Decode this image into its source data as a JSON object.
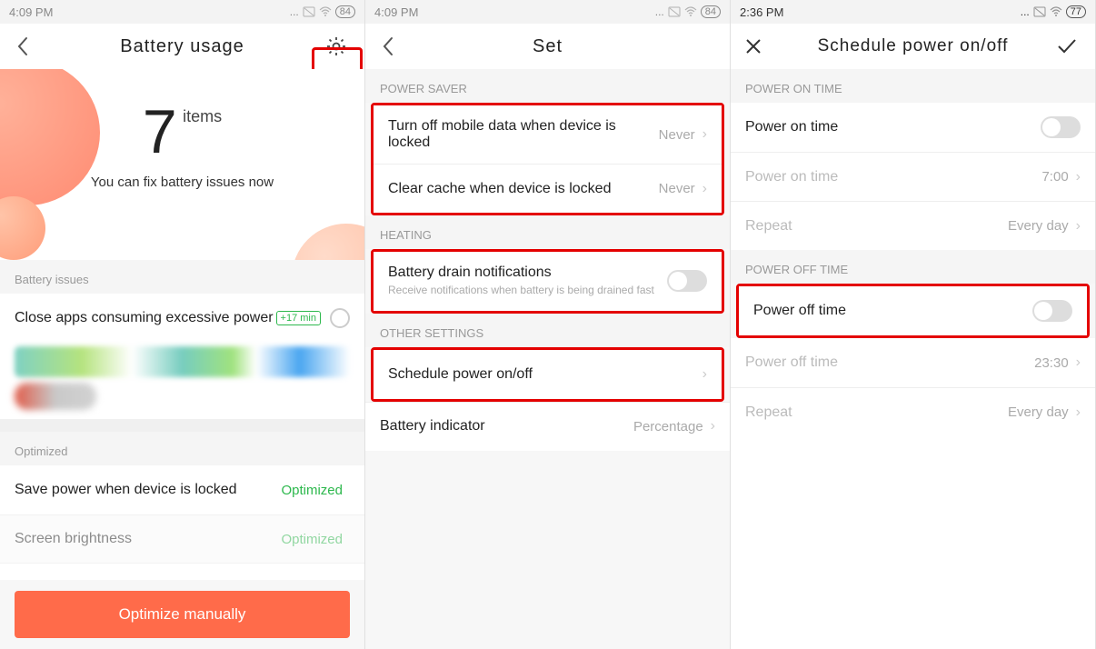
{
  "screen1": {
    "status_time": "4:09 PM",
    "status_batt": "84",
    "header_title": "Battery usage",
    "hero_count": "7",
    "hero_items": "items",
    "hero_sub": "You can fix battery issues now",
    "section_issues": "Battery issues",
    "row_close_apps": "Close apps consuming excessive power",
    "row_close_apps_tag": "+17 min",
    "section_optimized": "Optimized",
    "row_save_power": "Save power when device is locked",
    "row_save_power_val": "Optimized",
    "row_brightness": "Screen brightness",
    "row_brightness_val": "Optimized",
    "optimize_btn": "Optimize manually"
  },
  "screen2": {
    "status_time": "4:09 PM",
    "status_batt": "84",
    "header_title": "Set",
    "section_power_saver": "POWER SAVER",
    "row_mobile_data": "Turn off mobile data when device is locked",
    "row_mobile_data_val": "Never",
    "row_clear_cache": "Clear cache when device is locked",
    "row_clear_cache_val": "Never",
    "section_heating": "HEATING",
    "row_drain": "Battery drain notifications",
    "row_drain_sub": "Receive notifications when battery is being drained fast",
    "section_other": "OTHER SETTINGS",
    "row_schedule": "Schedule power on/off",
    "row_indicator": "Battery indicator",
    "row_indicator_val": "Percentage"
  },
  "screen3": {
    "status_time": "2:36 PM",
    "status_batt": "77",
    "header_title": "Schedule power on/off",
    "section_on": "POWER ON TIME",
    "row_on_toggle": "Power on time",
    "row_on_time_label": "Power on time",
    "row_on_time_val": "7:00",
    "row_on_repeat": "Repeat",
    "row_on_repeat_val": "Every day",
    "section_off": "POWER OFF TIME",
    "row_off_toggle": "Power off time",
    "row_off_time_label": "Power off time",
    "row_off_time_val": "23:30",
    "row_off_repeat": "Repeat",
    "row_off_repeat_val": "Every day"
  }
}
